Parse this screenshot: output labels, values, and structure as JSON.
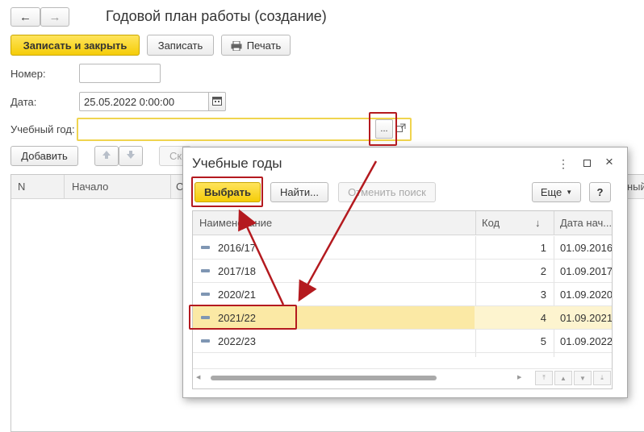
{
  "form": {
    "title": "Годовой план работы (создание)",
    "nav_back": "←",
    "nav_forward": "→"
  },
  "toolbar": {
    "save_close_label": "Записать и закрыть",
    "save_label": "Записать",
    "print_label": "Печать"
  },
  "fields": {
    "number_label": "Номер:",
    "number_value": "",
    "date_label": "Дата:",
    "date_value": "25.05.2022  0:00:00",
    "year_label": "Учебный год:",
    "year_value": "",
    "choose_button": "..."
  },
  "table_toolbar": {
    "add_label": "Добавить",
    "partial_label": "Ск"
  },
  "plan_table": {
    "columns": [
      "N",
      "Начало",
      "С"
    ],
    "right_partial": "ный"
  },
  "dialog": {
    "title": "Учебные годы",
    "toolbar": {
      "select_label": "Выбрать",
      "find_label": "Найти...",
      "cancel_search_label": "Отменить поиск",
      "more_label": "Еще",
      "help_label": "?"
    },
    "columns": {
      "name": "Наименование",
      "code": "Код",
      "sort_arrow": "↓",
      "start_date": "Дата нач..."
    },
    "rows": [
      {
        "name": "2016/17",
        "code": "1",
        "date": "01.09.2016",
        "selected": false
      },
      {
        "name": "2017/18",
        "code": "2",
        "date": "01.09.2017",
        "selected": false
      },
      {
        "name": "2020/21",
        "code": "3",
        "date": "01.09.2020",
        "selected": false
      },
      {
        "name": "2021/22",
        "code": "4",
        "date": "01.09.2021",
        "selected": true
      },
      {
        "name": "2022/23",
        "code": "5",
        "date": "01.09.2022",
        "selected": false
      }
    ]
  },
  "colors": {
    "accent_yellow": "#f5cd08",
    "selected_row": "#fbe9a5",
    "annotation_red": "#b41a1f"
  }
}
